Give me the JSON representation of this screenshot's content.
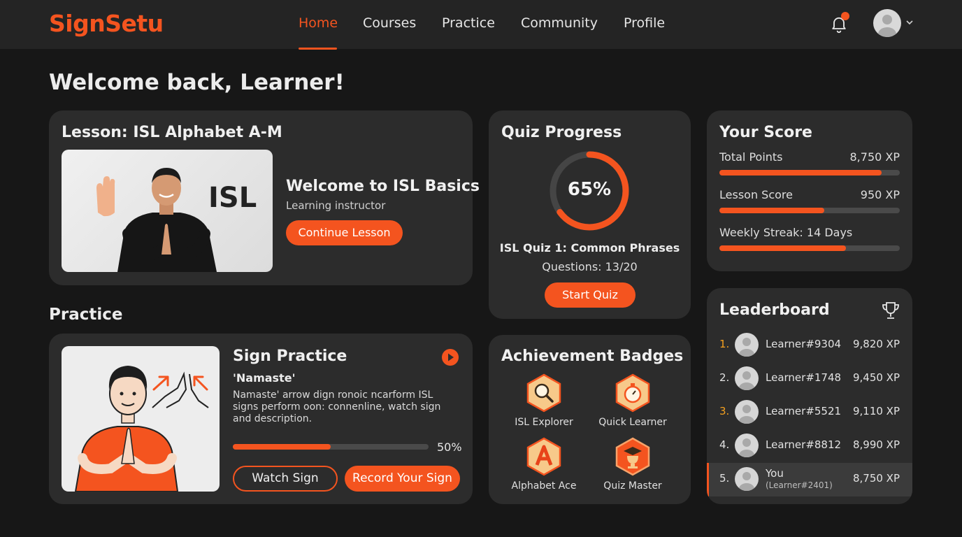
{
  "app": {
    "logo": "SignSetu"
  },
  "nav": {
    "items": [
      {
        "label": "Home",
        "active": true
      },
      {
        "label": "Courses",
        "active": false
      },
      {
        "label": "Practice",
        "active": false
      },
      {
        "label": "Community",
        "active": false
      },
      {
        "label": "Profile",
        "active": false
      }
    ]
  },
  "welcome": "Welcome back, Learner!",
  "lesson": {
    "title": "Lesson: ISL Alphabet A-M",
    "video_overlay": "ISL",
    "heading": "Welcome to ISL Basics",
    "subtitle": "Learning instructor",
    "button": "Continue Lesson"
  },
  "quiz": {
    "title": "Quiz Progress",
    "progress_label": "65%",
    "progress": 0.65,
    "name": "ISL Quiz 1: Common Phrases",
    "questions": "Questions: 13/20",
    "button": "Start Quiz"
  },
  "score": {
    "title": "Your Score",
    "rows": [
      {
        "label": "Total Points",
        "value": "8,750 XP",
        "fill": 0.9
      },
      {
        "label": "Lesson Score",
        "value": "950 XP",
        "fill": 0.58
      },
      {
        "label": "Weekly Streak: 14 Days",
        "value": "",
        "fill": 0.7
      }
    ]
  },
  "practice": {
    "section_title": "Practice",
    "card_title": "Sign Practice",
    "sign": "'Namaste'",
    "description_line1": "Namaste' arrow dign ronoic ncarform ISL",
    "description_line2": "signs perform oon: connenline, watch sign",
    "description_line3": "and description.",
    "progress_label": "50%",
    "progress": 0.5,
    "watch_button": "Watch Sign",
    "record_button": "Record Your Sign"
  },
  "badges": {
    "title": "Achievement Badges",
    "items": [
      {
        "label": "ISL Explorer",
        "icon": "magnifier-icon"
      },
      {
        "label": "Quick Learner",
        "icon": "stopwatch-icon"
      },
      {
        "label": "Alphabet Ace",
        "icon": "letter-a-icon"
      },
      {
        "label": "Quiz Master",
        "icon": "graduation-trophy-icon"
      }
    ]
  },
  "leaderboard": {
    "title": "Leaderboard",
    "rows": [
      {
        "rank": "1.",
        "name": "Learner#9304",
        "xp": "9,820 XP",
        "rank_color": "#f4a01f"
      },
      {
        "rank": "2.",
        "name": "Learner#1748",
        "xp": "9,450 XP",
        "rank_color": "#e2e2e2"
      },
      {
        "rank": "3.",
        "name": "Learner#5521",
        "xp": "9,110 XP",
        "rank_color": "#f4a01f"
      },
      {
        "rank": "4.",
        "name": "Learner#8812",
        "xp": "8,990 XP",
        "rank_color": "#e2e2e2"
      },
      {
        "rank": "5.",
        "name": "You",
        "subname": "(Learner#2401)",
        "xp": "8,750 XP",
        "rank_color": "#e2e2e2",
        "highlight": true
      }
    ]
  },
  "colors": {
    "accent": "#f4541f",
    "background": "#171717",
    "card": "#2c2c2c"
  }
}
